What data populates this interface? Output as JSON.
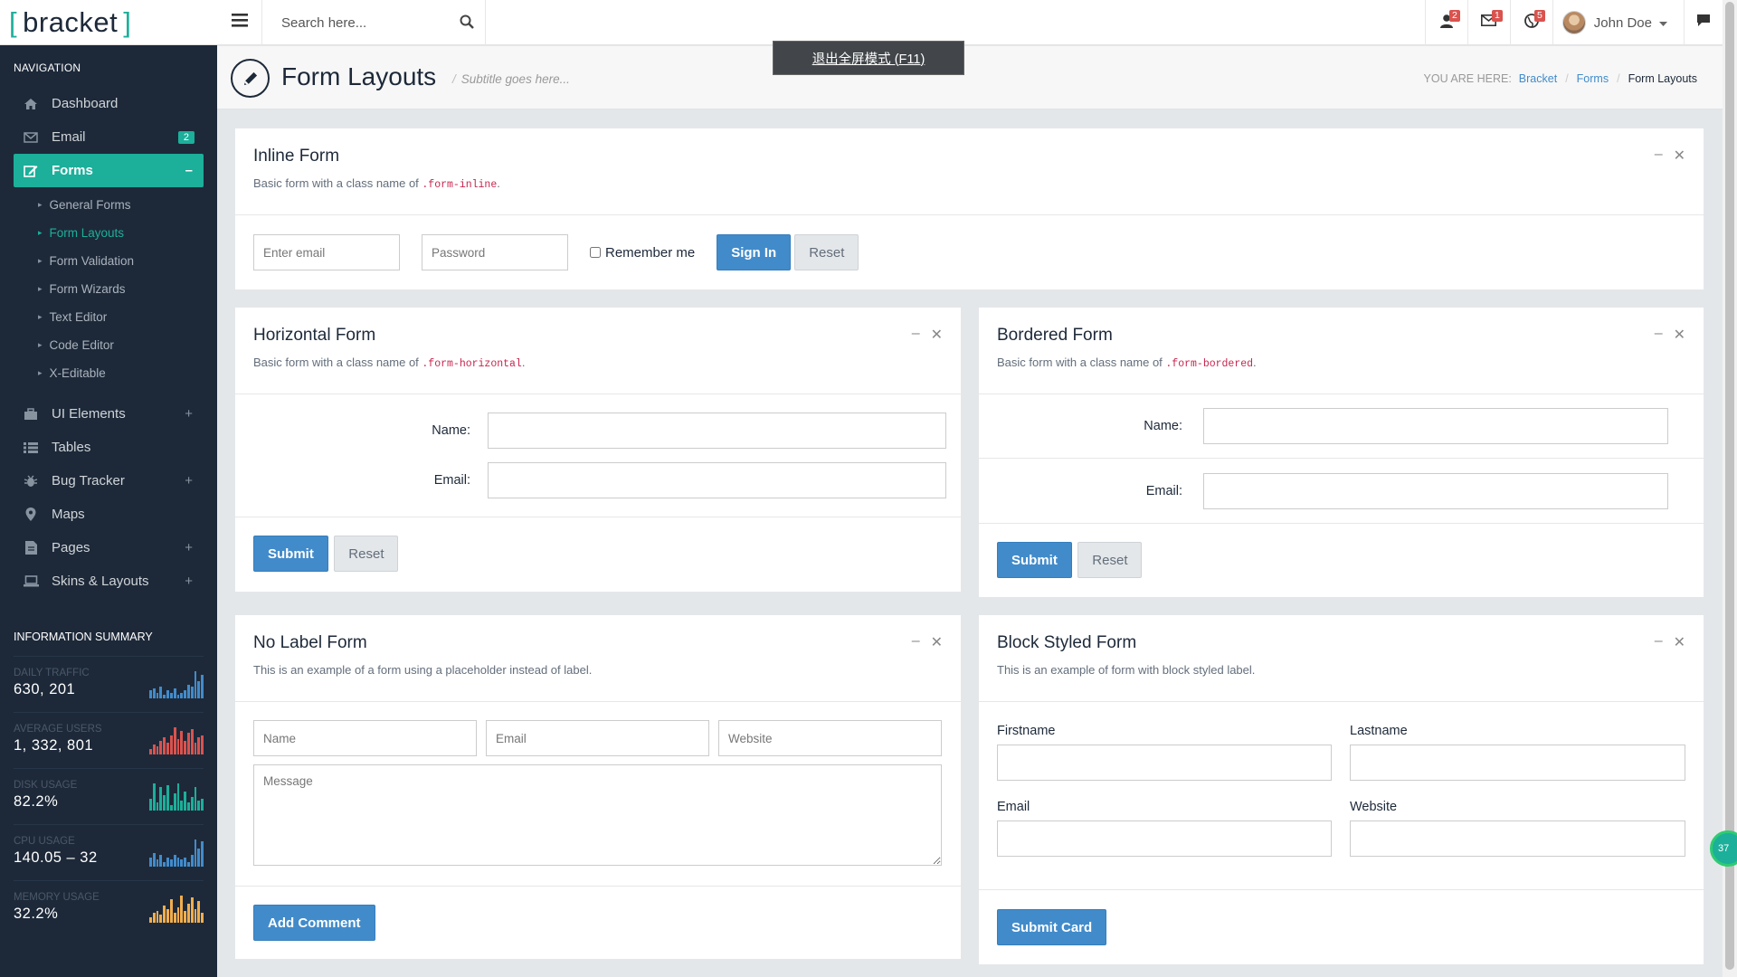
{
  "brand": {
    "open": "[",
    "name": "bracket",
    "close": "]"
  },
  "sidebar": {
    "nav_heading": "Navigation",
    "items": [
      {
        "label": "Dashboard",
        "icon": "home-icon"
      },
      {
        "label": "Email",
        "icon": "envelope-icon",
        "badge": "2"
      },
      {
        "label": "Forms",
        "icon": "edit-icon",
        "toggle": "–"
      },
      {
        "label": "UI Elements",
        "icon": "briefcase-icon",
        "toggle": "+"
      },
      {
        "label": "Tables",
        "icon": "table-list-icon"
      },
      {
        "label": "Bug Tracker",
        "icon": "bug-icon",
        "toggle": "+"
      },
      {
        "label": "Maps",
        "icon": "map-marker-icon"
      },
      {
        "label": "Pages",
        "icon": "file-icon",
        "toggle": "+"
      },
      {
        "label": "Skins & Layouts",
        "icon": "laptop-icon",
        "toggle": "+"
      }
    ],
    "forms_sub": [
      "General Forms",
      "Form Layouts",
      "Form Validation",
      "Form Wizards",
      "Text Editor",
      "Code Editor",
      "X-Editable"
    ],
    "info_heading": "Information Summary",
    "stats": [
      {
        "label": "Daily Traffic",
        "value": "630, 201",
        "color": "#428bca",
        "bars": [
          4,
          5,
          3,
          6,
          2,
          4,
          3,
          5,
          2,
          3,
          4,
          7,
          6,
          14,
          9,
          12
        ]
      },
      {
        "label": "Average Users",
        "value": "1, 332, 801",
        "color": "#d9534f",
        "bars": [
          3,
          5,
          4,
          7,
          9,
          6,
          10,
          14,
          8,
          12,
          7,
          11,
          13,
          6,
          9,
          10
        ]
      },
      {
        "label": "Disk Usage",
        "value": "82.2%",
        "color": "#1caf9a",
        "bars": [
          6,
          14,
          4,
          12,
          8,
          13,
          3,
          9,
          14,
          5,
          10,
          4,
          7,
          12,
          5,
          6
        ]
      },
      {
        "label": "CPU Usage",
        "value": "140.05 – 32",
        "color": "#428bca",
        "bars": [
          4,
          6,
          3,
          5,
          2,
          4,
          3,
          5,
          4,
          3,
          4,
          2,
          5,
          12,
          8,
          11
        ]
      },
      {
        "label": "Memory Usage",
        "value": "32.2%",
        "color": "#f0ad4e",
        "bars": [
          3,
          5,
          6,
          4,
          9,
          7,
          12,
          5,
          8,
          14,
          6,
          10,
          13,
          7,
          11,
          5
        ]
      }
    ]
  },
  "header": {
    "search_placeholder": "Search here...",
    "notif_counts": [
      "2",
      "1",
      "5"
    ],
    "user_name": "John Doe"
  },
  "toast": "退出全屏模式 (F11)",
  "page": {
    "title": "Form Layouts",
    "subtitle": "Subtitle goes here...",
    "breadcrumb_label": "You are here:",
    "crumbs": [
      "Bracket",
      "Forms",
      "Form Layouts"
    ]
  },
  "inline_form": {
    "title": "Inline Form",
    "desc": "Basic form with a class name of ",
    "code": ".form-inline",
    "email_ph": "Enter email",
    "password_ph": "Password",
    "remember": "Remember me",
    "signin": "Sign In",
    "reset": "Reset"
  },
  "horizontal_form": {
    "title": "Horizontal Form",
    "desc": "Basic form with a class name of ",
    "code": ".form-horizontal",
    "name_label": "Name:",
    "email_label": "Email:",
    "submit": "Submit",
    "reset": "Reset"
  },
  "bordered_form": {
    "title": "Bordered Form",
    "desc": "Basic form with a class name of ",
    "code": ".form-bordered",
    "name_label": "Name:",
    "email_label": "Email:",
    "submit": "Submit",
    "reset": "Reset"
  },
  "nolabel_form": {
    "title": "No Label Form",
    "desc": "This is an example of a form using a placeholder instead of label.",
    "name_ph": "Name",
    "email_ph": "Email",
    "website_ph": "Website",
    "message_ph": "Message",
    "submit": "Add Comment"
  },
  "block_form": {
    "title": "Block Styled Form",
    "desc": "This is an example of form with block styled label.",
    "firstname": "Firstname",
    "lastname": "Lastname",
    "email": "Email",
    "website": "Website",
    "submit": "Submit Card"
  },
  "panel_ctrl": {
    "minimize": "–",
    "close": "✕"
  },
  "bubble": "37",
  "colors": {
    "accent": "#1caf9a",
    "primary": "#428bca",
    "sidebar": "#1d2939",
    "danger": "#d9534f"
  }
}
